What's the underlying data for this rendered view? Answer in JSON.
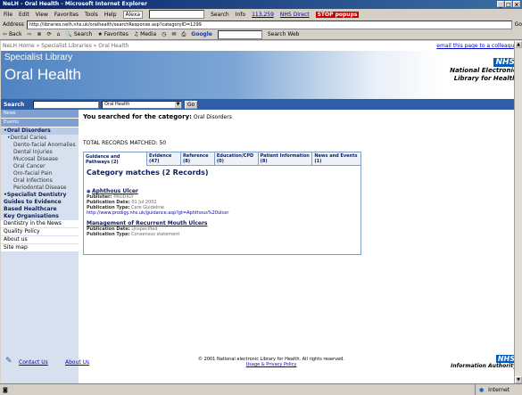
{
  "window": {
    "title": "NeLH - Oral Health - Microsoft Internet Explorer",
    "minimize": "_",
    "maximize": "□",
    "close": "×"
  },
  "menu": {
    "items": [
      "File",
      "Edit",
      "View",
      "Favorites",
      "Tools",
      "Help"
    ],
    "alexa": "Alexa",
    "search": "Search",
    "info": "Info",
    "count": "113,259",
    "nhs_direct": "NHS Direct",
    "popups": "STOP popups"
  },
  "address": {
    "label": "Address",
    "url": "http://libraries.nelh.nhs.uk/oralhealth/searchResponse.asp?categoryID=1299",
    "go": "Go"
  },
  "toolbar": {
    "back": "Back",
    "search": "Search",
    "favorites": "Favorites",
    "media": "Media",
    "google": "Google",
    "search_web": "Search Web"
  },
  "breadcrumb": {
    "text": "NeLH Home » Specialist Libraries » Oral Health",
    "email": "email this page to a colleague"
  },
  "banner": {
    "library": "Specialist Library",
    "title": "Oral Health",
    "nhs": "NHS",
    "nhs_text1": "National Electronic",
    "nhs_text2": "Library for Health"
  },
  "search": {
    "label": "Search",
    "selected": "Oral Health",
    "go": "Go"
  },
  "sidebar": {
    "news": "News",
    "events": "Events",
    "oral_disorders": "Oral Disorders",
    "dental_caries": "Dental Caries",
    "subs": [
      "Dento-facial Anomalies",
      "Dental Injuries",
      "Mucosal Disease",
      "Oral Cancer",
      "Oro-facial Pain",
      "Oral Infections",
      "Periodontal Disease"
    ],
    "specialist": "Specialist Dentistry",
    "guides": "Guides to Evidence Based Healthcare",
    "key_orgs": "Key Organisations",
    "news_item": "Dentistry in the News",
    "quality": "Quality Policy",
    "about": "About us",
    "sitemap": "Site map"
  },
  "main": {
    "query_prefix": "You searched for the category:",
    "query_value": "Oral Disorders",
    "total": "TOTAL RECORDS MATCHED: 50",
    "tabs": [
      "Guidance and Pathways (2)",
      "Evidence (47)",
      "Reference (8)",
      "Education/CPD (0)",
      "Patient Information (8)",
      "News and Events (1)"
    ],
    "matches": "Category matches (2 Records)",
    "records": [
      {
        "title": "Aphthous Ulcer",
        "publisher_label": "Publisher:",
        "publisher": "PRODIGY",
        "date_label": "Publication Date:",
        "date": "01 Jul 2002",
        "type_label": "Publication Type:",
        "type": "Care Guideline",
        "url": "http://www.prodigy.nhs.uk/guidance.asp?gt=Aphthous%20ulcer"
      },
      {
        "title": "Management of Recurrent Mouth Ulcers",
        "date_label": "Publication Date:",
        "date": "Unspecified",
        "type_label": "Publication Type:",
        "type": "Consensus statement"
      }
    ]
  },
  "footer": {
    "contact": "Contact Us",
    "about": "About Us",
    "copyright": "© 2001 National electronic Library for Health. All rights reserved.",
    "usage": "Usage & Privacy Policy",
    "nhs": "NHS",
    "authority": "Information Authority"
  },
  "status": {
    "zone": "Internet"
  }
}
